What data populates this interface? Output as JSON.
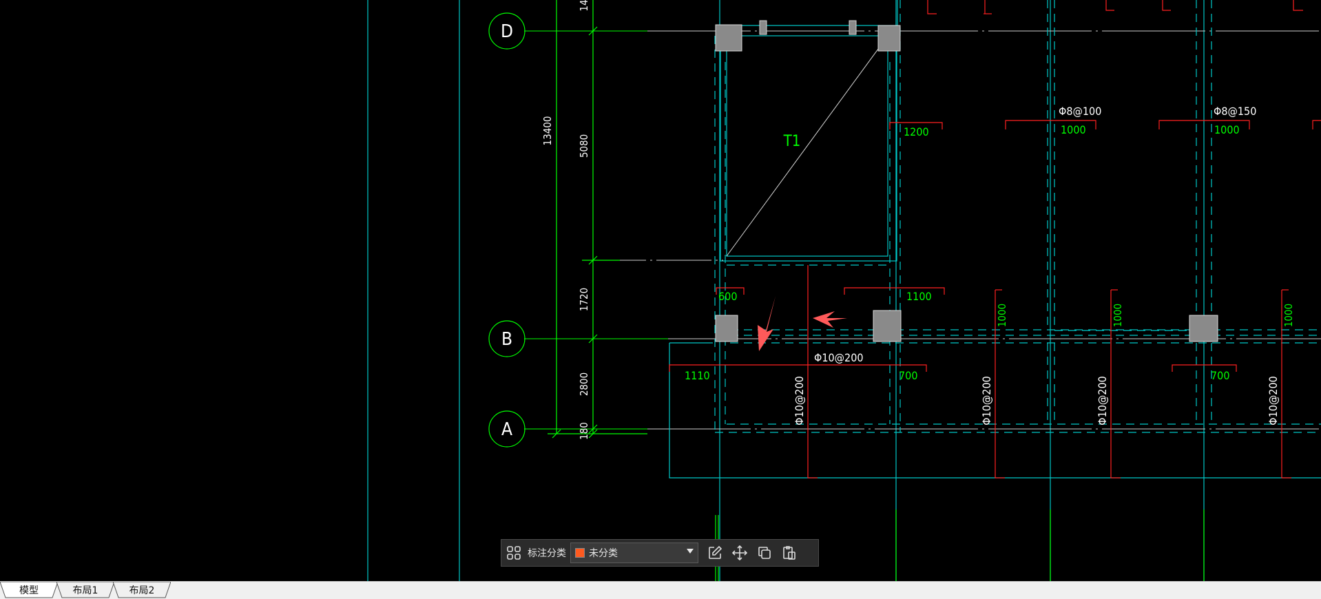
{
  "drawing": {
    "grid_bubbles": {
      "d": "D",
      "b": "B",
      "a": "A"
    },
    "dimensions": {
      "total": "13400",
      "d_seg": "5080",
      "b_seg": "1720",
      "a_seg": "2800",
      "edge": "180",
      "top_cut": "14"
    },
    "stair_label": "T1",
    "rebar": {
      "phi8_100": "Φ8@100",
      "phi8_150": "Φ8@150",
      "phi10_200_h": "Φ10@200",
      "phi10_200_v1": "Φ10@200",
      "phi10_200_v2": "Φ10@200",
      "phi10_200_v3": "Φ10@200",
      "phi10_200_v4": "Φ10@200"
    },
    "bar_lengths": {
      "l1200": "1200",
      "l1000a": "1000",
      "l1000b": "1000",
      "l600": "600",
      "l1100": "1100",
      "v1000a": "1000",
      "v1000b": "1000",
      "v1000c": "1000",
      "l1110": "1110",
      "l700a": "700",
      "l700b": "700"
    },
    "colors": {
      "green": "#00ff00",
      "cyan": "#00c8c8",
      "red": "#ff2020",
      "white": "#ffffff",
      "column": "#8a8a8a",
      "arrow": "#ff5a5a"
    }
  },
  "toolbar": {
    "label": "标注分类",
    "category_value": "未分类",
    "category_color": "#ff5a1f",
    "icons": [
      "layout-grid-icon",
      "edit-icon",
      "move-icon",
      "copy-icon",
      "paste-icon"
    ]
  },
  "tabs": [
    {
      "label": "模型",
      "active": true
    },
    {
      "label": "布局1",
      "active": false
    },
    {
      "label": "布局2",
      "active": false
    }
  ]
}
